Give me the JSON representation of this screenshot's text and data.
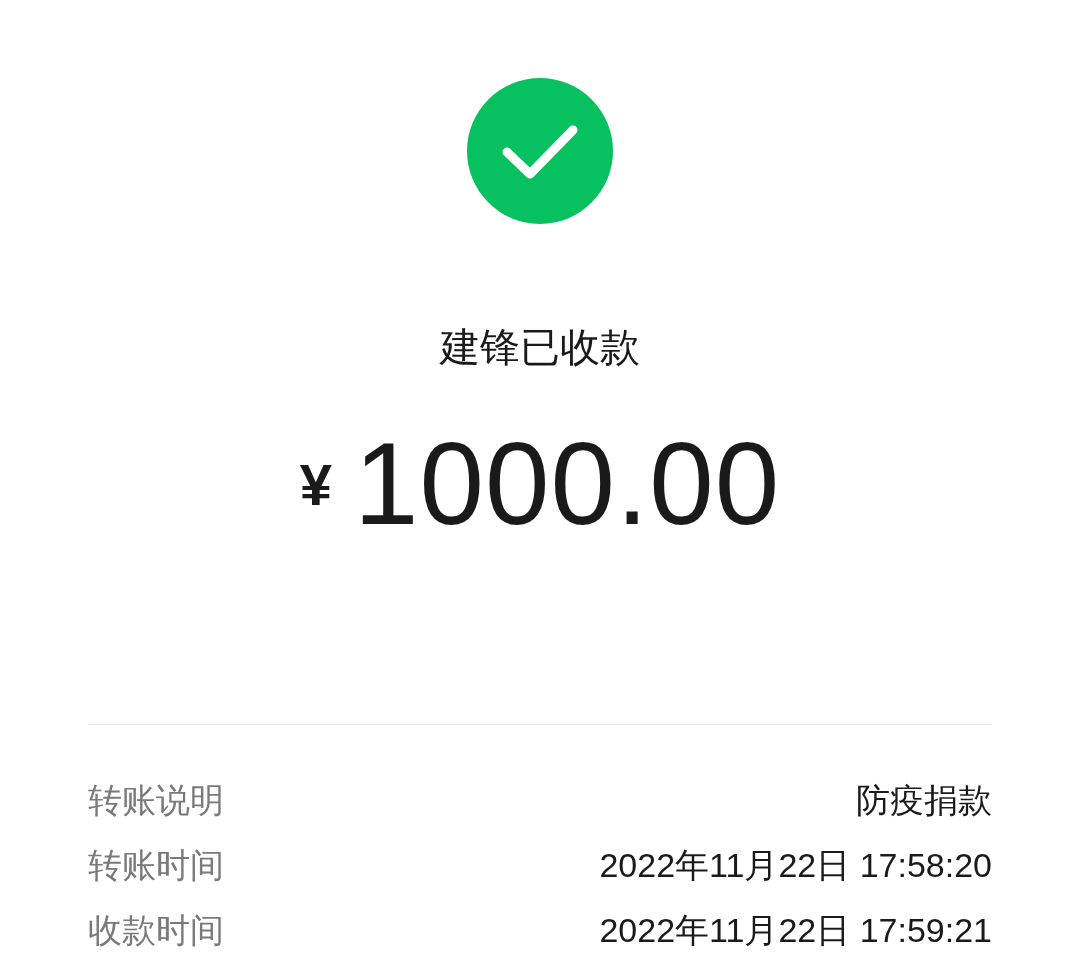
{
  "status": {
    "title": "建锋已收款",
    "currency": "¥",
    "amount": "1000.00"
  },
  "details": [
    {
      "label": "转账说明",
      "value": "防疫捐款"
    },
    {
      "label": "转账时间",
      "value": "2022年11月22日 17:58:20"
    },
    {
      "label": "收款时间",
      "value": "2022年11月22日 17:59:21"
    }
  ]
}
